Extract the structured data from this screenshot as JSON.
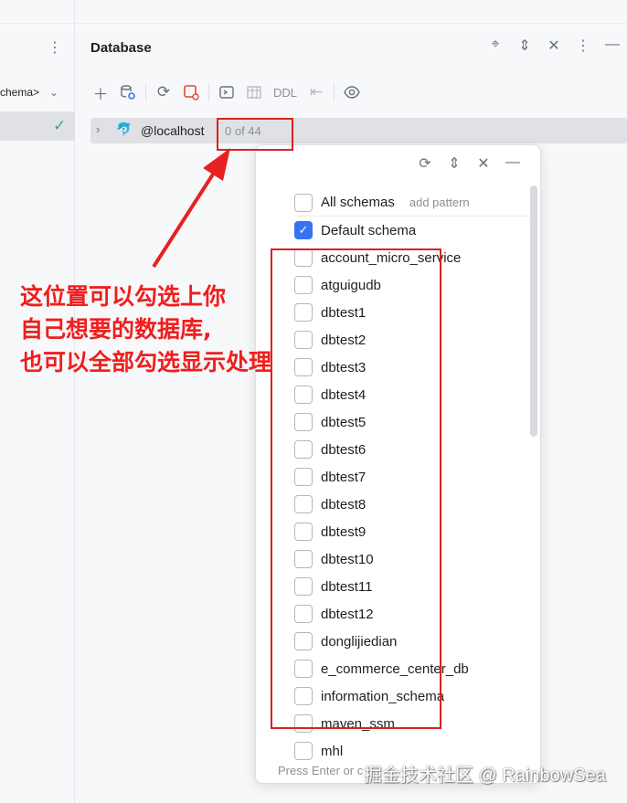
{
  "left_panel": {
    "schema_selector": "chema>"
  },
  "database_panel": {
    "title": "Database",
    "toolbar": {
      "ddl_label": "DDL"
    },
    "tree": {
      "host": "@localhost",
      "schema_count": "0 of 44"
    }
  },
  "schema_popup": {
    "items": [
      {
        "label": "All schemas",
        "checked": false
      },
      {
        "label": "Default schema",
        "checked": true
      },
      {
        "label": "account_micro_service",
        "checked": false
      },
      {
        "label": "atguigudb",
        "checked": false
      },
      {
        "label": "dbtest1",
        "checked": false
      },
      {
        "label": "dbtest2",
        "checked": false
      },
      {
        "label": "dbtest3",
        "checked": false
      },
      {
        "label": "dbtest4",
        "checked": false
      },
      {
        "label": "dbtest5",
        "checked": false
      },
      {
        "label": "dbtest6",
        "checked": false
      },
      {
        "label": "dbtest7",
        "checked": false
      },
      {
        "label": "dbtest8",
        "checked": false
      },
      {
        "label": "dbtest9",
        "checked": false
      },
      {
        "label": "dbtest10",
        "checked": false
      },
      {
        "label": "dbtest11",
        "checked": false
      },
      {
        "label": "dbtest12",
        "checked": false
      },
      {
        "label": "donglijiedian",
        "checked": false
      },
      {
        "label": "e_commerce_center_db",
        "checked": false
      },
      {
        "label": "information_schema",
        "checked": false
      },
      {
        "label": "maven_ssm",
        "checked": false
      },
      {
        "label": "mhl",
        "checked": false
      }
    ],
    "add_pattern": "add pattern",
    "footer": "Press Enter or c"
  },
  "annotation": {
    "lines": [
      "这位置可以勾选上你",
      "自己想要的数据库,",
      "也可以全部勾选显示处理"
    ],
    "color": "#f21d1d"
  },
  "watermark": "掘金技术社区 @ RainbowSea",
  "colors": {
    "accent": "#3574f0",
    "annotation_red": "#e02020",
    "check_green": "#3fa86b"
  }
}
